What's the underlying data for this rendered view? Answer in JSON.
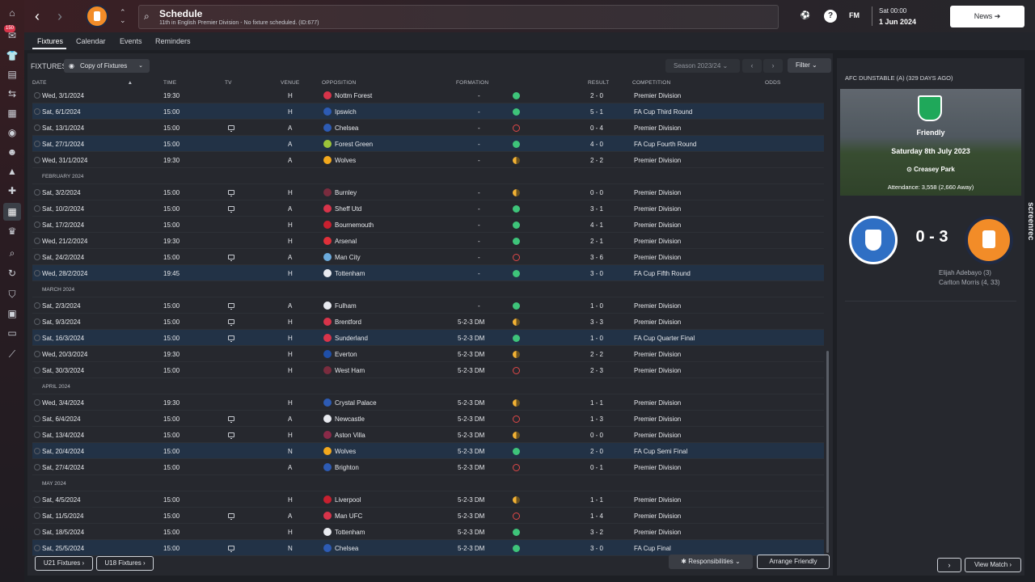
{
  "sidebar": {
    "badge": "150",
    "icons": [
      "home-icon",
      "inbox-icon",
      "kit-icon",
      "clipboard-icon",
      "transfer-icon",
      "report-icon",
      "ball-icon",
      "people-icon",
      "tactics-icon",
      "medical-icon",
      "schedule-icon",
      "trophy-icon",
      "search-icon",
      "refresh-icon",
      "shield-icon",
      "briefcase-icon",
      "cash-icon",
      "boots-icon"
    ]
  },
  "header": {
    "title": "Schedule",
    "subtitle": "11th in English Premier Division - No fixture scheduled. (ID:677)",
    "date_day": "Sat 00:00",
    "date_date": "1 Jun 2024",
    "fm_logo": "FM",
    "news_label": "News"
  },
  "tabs": [
    "Fixtures",
    "Calendar",
    "Events",
    "Reminders"
  ],
  "toolbar": {
    "fixtures_label": "FIXTURES",
    "copy_label": "Copy of Fixtures",
    "season_label": "Season 2023/24",
    "filter_label": "Filter"
  },
  "columns": {
    "date": "DATE",
    "time": "TIME",
    "tv": "TV",
    "venue": "VENUE",
    "opposition": "OPPOSITION",
    "formation": "FORMATION",
    "result": "RESULT",
    "competition": "COMPETITION",
    "odds": "ODDS"
  },
  "rows": [
    {
      "kind": "match",
      "date": "Wed, 3/1/2024",
      "time": "19:30",
      "tv": false,
      "venue": "H",
      "opp": "Nottm Forest",
      "crest": "#d8344a",
      "form": "-",
      "res": "2 - 0",
      "out": "win",
      "comp": "Premier Division",
      "cup": false
    },
    {
      "kind": "match",
      "date": "Sat, 6/1/2024",
      "time": "15:00",
      "tv": false,
      "venue": "H",
      "opp": "Ipswich",
      "crest": "#2d5bb4",
      "form": "-",
      "res": "5 - 1",
      "out": "win",
      "comp": "FA Cup Third Round",
      "cup": true
    },
    {
      "kind": "match",
      "date": "Sat, 13/1/2024",
      "time": "15:00",
      "tv": true,
      "venue": "A",
      "opp": "Chelsea",
      "crest": "#2d5bb4",
      "form": "-",
      "res": "0 - 4",
      "out": "loss",
      "comp": "Premier Division",
      "cup": false
    },
    {
      "kind": "match",
      "date": "Sat, 27/1/2024",
      "time": "15:00",
      "tv": false,
      "venue": "A",
      "opp": "Forest Green",
      "crest": "#9cc43a",
      "form": "-",
      "res": "4 - 0",
      "out": "win",
      "comp": "FA Cup Fourth Round",
      "cup": true
    },
    {
      "kind": "match",
      "date": "Wed, 31/1/2024",
      "time": "19:30",
      "tv": false,
      "venue": "A",
      "opp": "Wolves",
      "crest": "#f2a81d",
      "form": "-",
      "res": "2 - 2",
      "out": "draw",
      "comp": "Premier Division",
      "cup": false
    },
    {
      "kind": "month",
      "label": "FEBRUARY 2024"
    },
    {
      "kind": "match",
      "date": "Sat, 3/2/2024",
      "time": "15:00",
      "tv": true,
      "venue": "H",
      "opp": "Burnley",
      "crest": "#7a2c3e",
      "form": "-",
      "res": "0 - 0",
      "out": "draw",
      "comp": "Premier Division",
      "cup": false
    },
    {
      "kind": "match",
      "date": "Sat, 10/2/2024",
      "time": "15:00",
      "tv": true,
      "venue": "A",
      "opp": "Sheff Utd",
      "crest": "#d8344a",
      "form": "-",
      "res": "3 - 1",
      "out": "win",
      "comp": "Premier Division",
      "cup": false
    },
    {
      "kind": "match",
      "date": "Sat, 17/2/2024",
      "time": "15:00",
      "tv": false,
      "venue": "H",
      "opp": "Bournemouth",
      "crest": "#c8202f",
      "form": "-",
      "res": "4 - 1",
      "out": "win",
      "comp": "Premier Division",
      "cup": false
    },
    {
      "kind": "match",
      "date": "Wed, 21/2/2024",
      "time": "19:30",
      "tv": false,
      "venue": "H",
      "opp": "Arsenal",
      "crest": "#e0303a",
      "form": "-",
      "res": "2 - 1",
      "out": "win",
      "comp": "Premier Division",
      "cup": false
    },
    {
      "kind": "match",
      "date": "Sat, 24/2/2024",
      "time": "15:00",
      "tv": true,
      "venue": "A",
      "opp": "Man City",
      "crest": "#6cabdd",
      "form": "-",
      "res": "3 - 6",
      "out": "loss",
      "comp": "Premier Division",
      "cup": false
    },
    {
      "kind": "match",
      "date": "Wed, 28/2/2024",
      "time": "19:45",
      "tv": false,
      "venue": "H",
      "opp": "Tottenham",
      "crest": "#e8eaf0",
      "form": "-",
      "res": "3 - 0",
      "out": "win",
      "comp": "FA Cup Fifth Round",
      "cup": true
    },
    {
      "kind": "month",
      "label": "MARCH 2024"
    },
    {
      "kind": "match",
      "date": "Sat, 2/3/2024",
      "time": "15:00",
      "tv": true,
      "venue": "A",
      "opp": "Fulham",
      "crest": "#e8eaf0",
      "form": "-",
      "res": "1 - 0",
      "out": "win",
      "comp": "Premier Division",
      "cup": false
    },
    {
      "kind": "match",
      "date": "Sat, 9/3/2024",
      "time": "15:00",
      "tv": true,
      "venue": "H",
      "opp": "Brentford",
      "crest": "#d8344a",
      "form": "5-2-3 DM",
      "res": "3 - 3",
      "out": "draw",
      "comp": "Premier Division",
      "cup": false
    },
    {
      "kind": "match",
      "date": "Sat, 16/3/2024",
      "time": "15:00",
      "tv": true,
      "venue": "H",
      "opp": "Sunderland",
      "crest": "#d8344a",
      "form": "5-2-3 DM",
      "res": "1 - 0",
      "out": "win",
      "comp": "FA Cup Quarter Final",
      "cup": true
    },
    {
      "kind": "match",
      "date": "Wed, 20/3/2024",
      "time": "19:30",
      "tv": false,
      "venue": "H",
      "opp": "Everton",
      "crest": "#1f4fa8",
      "form": "5-2-3 DM",
      "res": "2 - 2",
      "out": "draw",
      "comp": "Premier Division",
      "cup": false
    },
    {
      "kind": "match",
      "date": "Sat, 30/3/2024",
      "time": "15:00",
      "tv": false,
      "venue": "H",
      "opp": "West Ham",
      "crest": "#7a2c3e",
      "form": "5-2-3 DM",
      "res": "2 - 3",
      "out": "loss",
      "comp": "Premier Division",
      "cup": false
    },
    {
      "kind": "month",
      "label": "APRIL 2024"
    },
    {
      "kind": "match",
      "date": "Wed, 3/4/2024",
      "time": "19:30",
      "tv": false,
      "venue": "H",
      "opp": "Crystal Palace",
      "crest": "#2d5bb4",
      "form": "5-2-3 DM",
      "res": "1 - 1",
      "out": "draw",
      "comp": "Premier Division",
      "cup": false
    },
    {
      "kind": "match",
      "date": "Sat, 6/4/2024",
      "time": "15:00",
      "tv": true,
      "venue": "A",
      "opp": "Newcastle",
      "crest": "#e8eaf0",
      "form": "5-2-3 DM",
      "res": "1 - 3",
      "out": "loss",
      "comp": "Premier Division",
      "cup": false
    },
    {
      "kind": "match",
      "date": "Sat, 13/4/2024",
      "time": "15:00",
      "tv": true,
      "venue": "H",
      "opp": "Aston Villa",
      "crest": "#8a2a48",
      "form": "5-2-3 DM",
      "res": "0 - 0",
      "out": "draw",
      "comp": "Premier Division",
      "cup": false
    },
    {
      "kind": "match",
      "date": "Sat, 20/4/2024",
      "time": "15:00",
      "tv": false,
      "venue": "N",
      "opp": "Wolves",
      "crest": "#f2a81d",
      "form": "5-2-3 DM",
      "res": "2 - 0",
      "out": "win",
      "comp": "FA Cup Semi Final",
      "cup": true
    },
    {
      "kind": "match",
      "date": "Sat, 27/4/2024",
      "time": "15:00",
      "tv": false,
      "venue": "A",
      "opp": "Brighton",
      "crest": "#2d5bb4",
      "form": "5-2-3 DM",
      "res": "0 - 1",
      "out": "loss",
      "comp": "Premier Division",
      "cup": false
    },
    {
      "kind": "month",
      "label": "MAY 2024"
    },
    {
      "kind": "match",
      "date": "Sat, 4/5/2024",
      "time": "15:00",
      "tv": false,
      "venue": "H",
      "opp": "Liverpool",
      "crest": "#c8202f",
      "form": "5-2-3 DM",
      "res": "1 - 1",
      "out": "draw",
      "comp": "Premier Division",
      "cup": false
    },
    {
      "kind": "match",
      "date": "Sat, 11/5/2024",
      "time": "15:00",
      "tv": true,
      "venue": "A",
      "opp": "Man UFC",
      "crest": "#d8344a",
      "form": "5-2-3 DM",
      "res": "1 - 4",
      "out": "loss",
      "comp": "Premier Division",
      "cup": false
    },
    {
      "kind": "match",
      "date": "Sat, 18/5/2024",
      "time": "15:00",
      "tv": false,
      "venue": "H",
      "opp": "Tottenham",
      "crest": "#e8eaf0",
      "form": "5-2-3 DM",
      "res": "3 - 2",
      "out": "win",
      "comp": "Premier Division",
      "cup": false
    },
    {
      "kind": "match",
      "date": "Sat, 25/5/2024",
      "time": "15:00",
      "tv": true,
      "venue": "N",
      "opp": "Chelsea",
      "crest": "#2d5bb4",
      "form": "5-2-3 DM",
      "res": "3 - 0",
      "out": "win",
      "comp": "FA Cup Final",
      "cup": true
    }
  ],
  "footer": {
    "u21": "U21 Fixtures",
    "u18": "U18 Fixtures",
    "responsibilities": "Responsibilities",
    "arrange": "Arrange Friendly"
  },
  "panel": {
    "heading": "AFC DUNSTABLE (A) (329 DAYS AGO)",
    "match_type": "Friendly",
    "match_date": "Saturday 8th July 2023",
    "stadium": "Creasey Park",
    "attendance": "Attendance: 3,558 (2,660 Away)",
    "score": "0 - 3",
    "scorers": [
      "Elijah Adebayo (3)",
      "Carlton Morris (4, 33)"
    ],
    "view_match": "View Match"
  },
  "watermark": "screenrec"
}
